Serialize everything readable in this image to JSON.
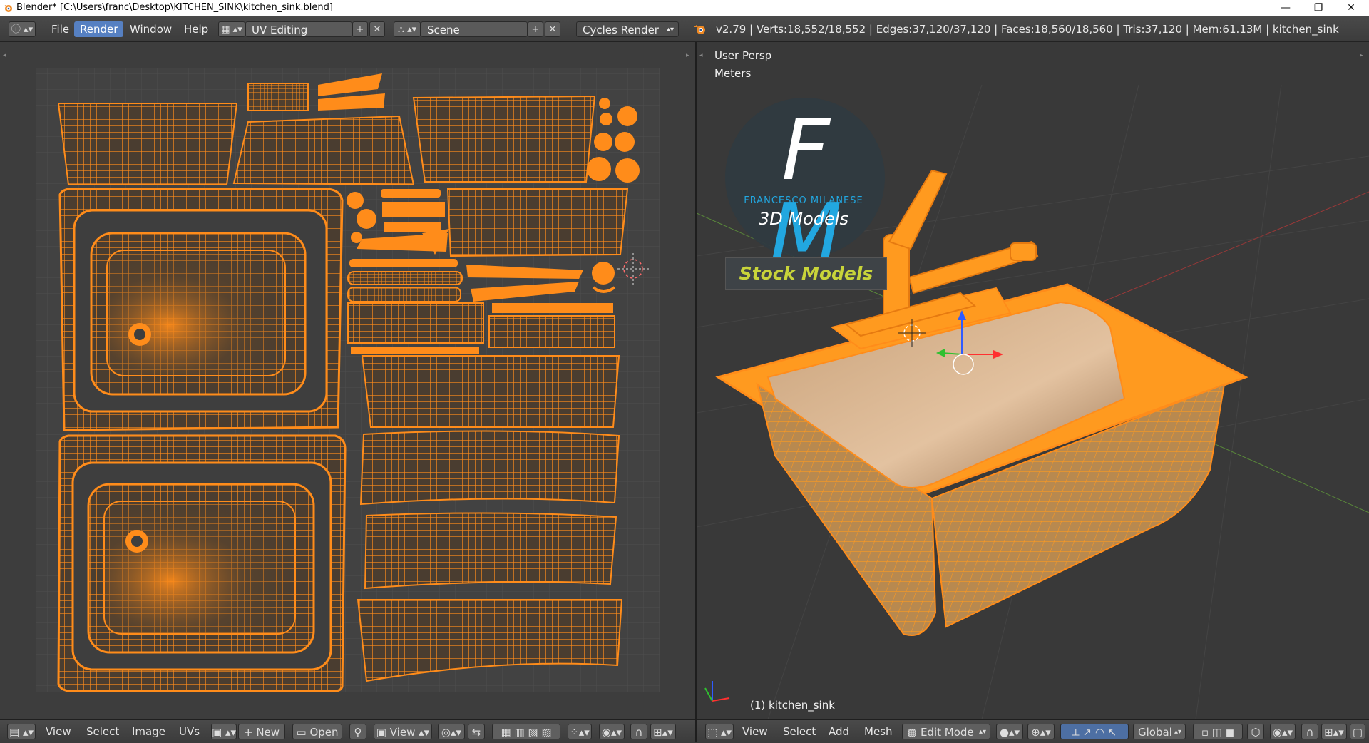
{
  "window": {
    "title": "Blender* [C:\\Users\\franc\\Desktop\\KITCHEN_SINK\\kitchen_sink.blend]",
    "minimize_glyph": "—",
    "restore_glyph": "❐",
    "close_glyph": "✕"
  },
  "topbar": {
    "menu": [
      "File",
      "Render",
      "Window",
      "Help"
    ],
    "active_menu": "Render",
    "screen_layout": "UV Editing",
    "scene": "Scene",
    "render_engine": "Cycles Render",
    "stats": "v2.79 | Verts:18,552/18,552 | Edges:37,120/37,120 | Faces:18,560/18,560 | Tris:37,120 | Mem:61.13M | kitchen_sink"
  },
  "uv_editor": {
    "menu": [
      "View",
      "Select",
      "Image",
      "UVs"
    ],
    "new_label": "New",
    "open_label": "Open",
    "view_label": "View"
  },
  "viewport": {
    "view_name": "User Persp",
    "units": "Meters",
    "object_label": "(1) kitchen_sink",
    "menu": [
      "View",
      "Select",
      "Add",
      "Mesh"
    ],
    "mode": "Edit Mode",
    "orientation": "Global"
  },
  "logo": {
    "letters": "FM",
    "name": "FRANCESCO MILANESE",
    "subtitle": "3D Models",
    "badge": "Stock Models"
  },
  "colors": {
    "uv_orange": "#ff8c1a",
    "accent_blue": "#5680c2",
    "logo_blue": "#22a7e0",
    "badge_yellow": "#c8d43a"
  }
}
